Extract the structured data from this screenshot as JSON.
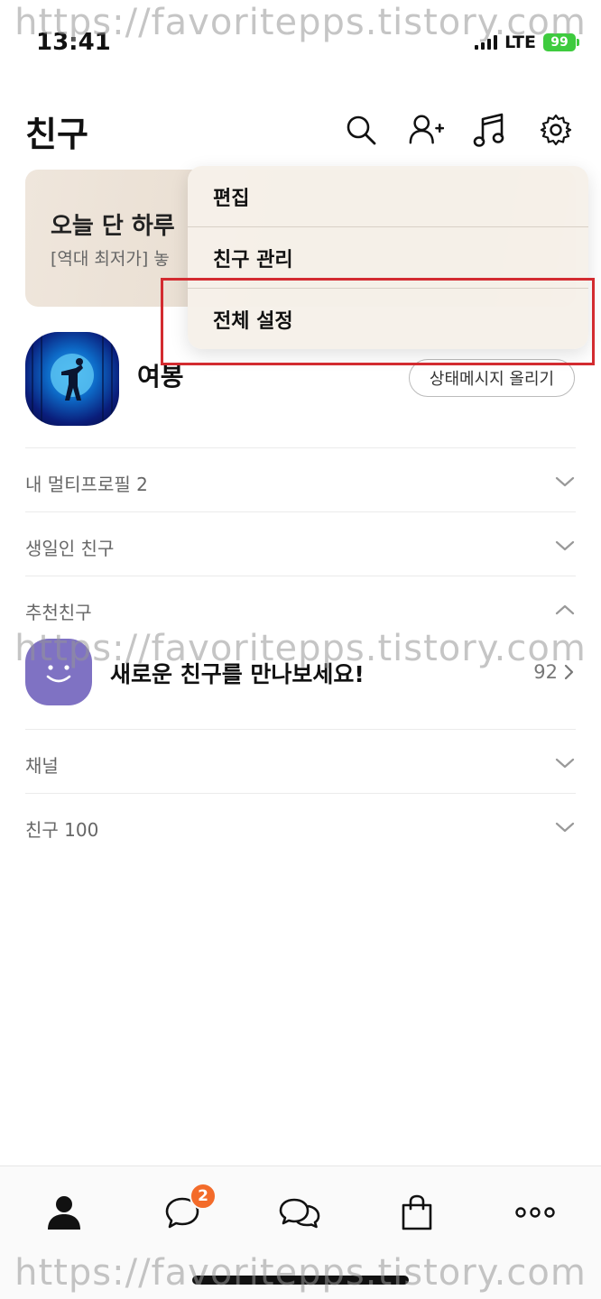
{
  "watermark": "https://favoritepps.tistory.com",
  "status_bar": {
    "time": "13:41",
    "network": "LTE",
    "battery": "99"
  },
  "header": {
    "title": "친구",
    "icons": [
      "search-icon",
      "add-friend-icon",
      "music-icon",
      "settings-icon"
    ]
  },
  "banner": {
    "title": "오늘 단 하루",
    "subtitle": "[역대 최저가] 놓"
  },
  "dropdown": {
    "items": [
      {
        "label": "편집"
      },
      {
        "label": "친구 관리"
      },
      {
        "label": "전체 설정"
      }
    ],
    "highlight_color": "#d32b30"
  },
  "profile": {
    "name": "여봉",
    "status_button": "상태메시지 올리기"
  },
  "sections": {
    "multi_profile": "내 멀티프로필 2",
    "birthday": "생일인 친구",
    "recommended": "추천친구",
    "channel": "채널",
    "friends": "친구 100"
  },
  "recommended": {
    "text": "새로운 친구를 만나보세요!",
    "count": "92"
  },
  "bottom_nav": {
    "items": [
      "friends-icon",
      "chat-icon",
      "openchat-icon",
      "shopping-icon",
      "more-icon"
    ],
    "chat_badge": "2",
    "badge_color": "#f36b2a"
  }
}
